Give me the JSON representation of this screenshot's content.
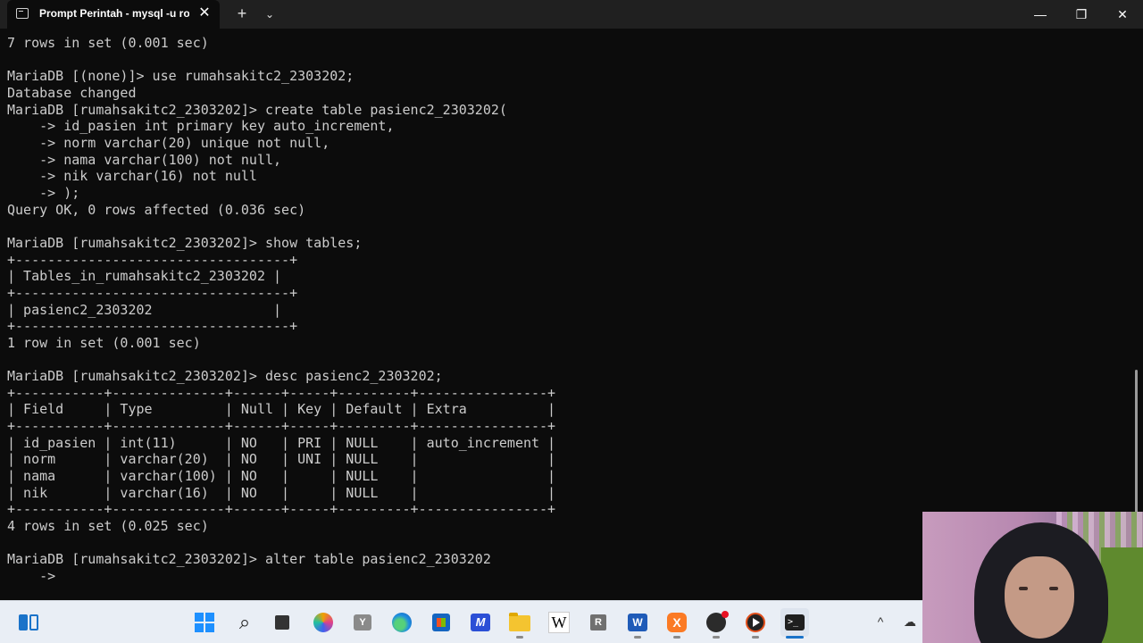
{
  "window": {
    "tab_title": "Prompt Perintah - mysql  -u root",
    "icons": {
      "tab": "terminal-icon",
      "close": "close-icon",
      "new_tab": "plus-icon",
      "dropdown": "chevron-down-icon",
      "minimize": "minimize-icon",
      "maximize": "restore-icon",
      "win_close": "close-icon"
    }
  },
  "terminal": {
    "text_color": "#cccccc",
    "background": "#0c0c0c",
    "lines": [
      "7 rows in set (0.001 sec)",
      "",
      "MariaDB [(none)]> use rumahsakitc2_2303202;",
      "Database changed",
      "MariaDB [rumahsakitc2_2303202]> create table pasienc2_2303202(",
      "    -> id_pasien int primary key auto_increment,",
      "    -> norm varchar(20) unique not null,",
      "    -> nama varchar(100) not null,",
      "    -> nik varchar(16) not null",
      "    -> );",
      "Query OK, 0 rows affected (0.036 sec)",
      "",
      "MariaDB [rumahsakitc2_2303202]> show tables;",
      "+----------------------------------+",
      "| Tables_in_rumahsakitc2_2303202 |",
      "+----------------------------------+",
      "| pasienc2_2303202               |",
      "+----------------------------------+",
      "1 row in set (0.001 sec)",
      "",
      "MariaDB [rumahsakitc2_2303202]> desc pasienc2_2303202;",
      "+-----------+--------------+------+-----+---------+----------------+",
      "| Field     | Type         | Null | Key | Default | Extra          |",
      "+-----------+--------------+------+-----+---------+----------------+",
      "| id_pasien | int(11)      | NO   | PRI | NULL    | auto_increment |",
      "| norm      | varchar(20)  | NO   | UNI | NULL    |                |",
      "| nama      | varchar(100) | NO   |     | NULL    |                |",
      "| nik       | varchar(16)  | NO   |     | NULL    |                |",
      "+-----------+--------------+------+-----+---------+----------------+",
      "4 rows in set (0.025 sec)",
      "",
      "MariaDB [rumahsakitc2_2303202]> alter table pasienc2_2303202",
      "    ->"
    ]
  },
  "taskbar": {
    "background": "#e9eef5",
    "items": [
      {
        "name": "widgets-icon"
      },
      {
        "name": "windows-start-icon"
      },
      {
        "name": "search-icon"
      },
      {
        "name": "task-view-icon"
      },
      {
        "name": "copilot-icon"
      },
      {
        "name": "app-icon",
        "label": "Y"
      },
      {
        "name": "edge-icon"
      },
      {
        "name": "store-icon"
      },
      {
        "name": "editor-icon",
        "label": "M"
      },
      {
        "name": "file-explorer-icon"
      },
      {
        "name": "wikipedia-icon",
        "label": "W"
      },
      {
        "name": "rstudio-icon",
        "label": "R"
      },
      {
        "name": "word-icon",
        "label": "W"
      },
      {
        "name": "xampp-icon",
        "label": "X"
      },
      {
        "name": "obs-icon"
      },
      {
        "name": "media-player-icon"
      },
      {
        "name": "terminal-icon",
        "label": ">_"
      }
    ],
    "tray": {
      "chevron": "^",
      "network": "☁"
    }
  }
}
